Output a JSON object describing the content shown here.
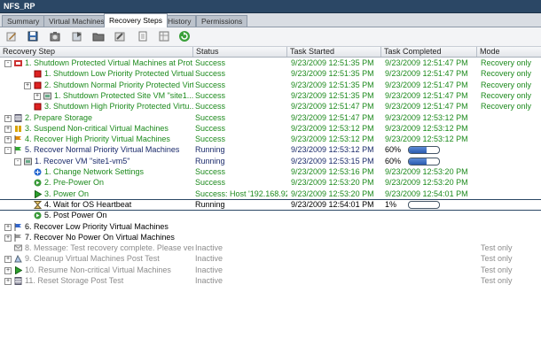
{
  "window": {
    "title": "NFS_RP"
  },
  "tabs": [
    {
      "label": "Summary",
      "active": false
    },
    {
      "label": "Virtual Machines",
      "active": false
    },
    {
      "label": "Recovery Steps",
      "active": true
    },
    {
      "label": "History",
      "active": false
    },
    {
      "label": "Permissions",
      "active": false
    }
  ],
  "toolbar": {
    "buttons": [
      "edit-icon",
      "save-icon",
      "camera-icon",
      "export-icon",
      "folder-icon",
      "wrench-icon",
      "document-icon",
      "grid-icon",
      "refresh-icon"
    ]
  },
  "columns": {
    "step": "Recovery Step",
    "status": "Status",
    "started": "Task Started",
    "completed": "Task Completed",
    "mode": "Mode"
  },
  "rows": [
    {
      "step": "1. Shutdown Protected Virtual Machines at Prot...",
      "status": "Success",
      "started": "9/23/2009 12:51:35 PM",
      "completed": "9/23/2009 12:51:47 PM",
      "mode": "Recovery only",
      "color": "green",
      "icon": "shutdown-group-icon"
    },
    {
      "step": "1. Shutdown Low Priority Protected Virtual...",
      "status": "Success",
      "started": "9/23/2009 12:51:35 PM",
      "completed": "9/23/2009 12:51:47 PM",
      "mode": "Recovery only",
      "color": "green",
      "icon": "stop-icon"
    },
    {
      "step": "2. Shutdown Normal Priority Protected Virtu...",
      "status": "Success",
      "started": "9/23/2009 12:51:35 PM",
      "completed": "9/23/2009 12:51:47 PM",
      "mode": "Recovery only",
      "color": "green",
      "icon": "stop-icon"
    },
    {
      "step": "1. Shutdown Protected Site VM \"site1...",
      "status": "Success",
      "started": "9/23/2009 12:51:35 PM",
      "completed": "9/23/2009 12:51:47 PM",
      "mode": "Recovery only",
      "color": "green",
      "icon": "vm-icon"
    },
    {
      "step": "3. Shutdown High Priority Protected Virtu...",
      "status": "Success",
      "started": "9/23/2009 12:51:47 PM",
      "completed": "9/23/2009 12:51:47 PM",
      "mode": "Recovery only",
      "color": "green",
      "icon": "stop-icon"
    },
    {
      "step": "2. Prepare Storage",
      "status": "Success",
      "started": "9/23/2009 12:51:47 PM",
      "completed": "9/23/2009 12:53:12 PM",
      "mode": "",
      "color": "green",
      "icon": "storage-icon"
    },
    {
      "step": "3. Suspend Non-critical Virtual Machines",
      "status": "Success",
      "started": "9/23/2009 12:53:12 PM",
      "completed": "9/23/2009 12:53:12 PM",
      "mode": "",
      "color": "green",
      "icon": "pause-icon"
    },
    {
      "step": "4. Recover High Priority Virtual Machines",
      "status": "Success",
      "started": "9/23/2009 12:53:12 PM",
      "completed": "9/23/2009 12:53:12 PM",
      "mode": "",
      "color": "green",
      "icon": "flag-icon"
    },
    {
      "step": "5. Recover Normal Priority Virtual Machines",
      "status": "Running",
      "started": "9/23/2009 12:53:12 PM",
      "completed": "60%",
      "mode": "",
      "color": "navy",
      "icon": "flag-green-icon",
      "progress": 0.6
    },
    {
      "step": "1. Recover VM \"site1-vm5\"",
      "status": "Running",
      "started": "9/23/2009 12:53:15 PM",
      "completed": "60%",
      "mode": "",
      "color": "navy",
      "icon": "vm-icon",
      "progress": 0.6
    },
    {
      "step": "1. Change Network Settings",
      "status": "Success",
      "started": "9/23/2009 12:53:16 PM",
      "completed": "9/23/2009 12:53:20 PM",
      "mode": "",
      "color": "green",
      "icon": "network-icon"
    },
    {
      "step": "2. Pre-Power On",
      "status": "Success",
      "started": "9/23/2009 12:53:20 PM",
      "completed": "9/23/2009 12:53:20 PM",
      "mode": "",
      "color": "green",
      "icon": "script-icon"
    },
    {
      "step": "3. Power On",
      "status": "Success: Host '192.168.92....",
      "started": "9/23/2009 12:53:20 PM",
      "completed": "9/23/2009 12:54:01 PM",
      "mode": "",
      "color": "green",
      "icon": "play-icon"
    },
    {
      "step": "4. Wait for OS Heartbeat",
      "status": "Running",
      "started": "9/23/2009 12:54:01 PM",
      "completed": "1%",
      "mode": "",
      "color": "black",
      "icon": "hourglass-icon",
      "progress": 0.01,
      "selected": true
    },
    {
      "step": "5. Post Power On",
      "status": "",
      "started": "",
      "completed": "",
      "mode": "",
      "color": "black",
      "icon": "script-icon"
    },
    {
      "step": "6. Recover Low Priority Virtual Machines",
      "status": "",
      "started": "",
      "completed": "",
      "mode": "",
      "color": "black",
      "icon": "flag-blue-icon"
    },
    {
      "step": "7. Recover No Power On Virtual Machines",
      "status": "",
      "started": "",
      "completed": "",
      "mode": "",
      "color": "black",
      "icon": "flag-gray-icon"
    },
    {
      "step": "8. Message: Test recovery complete. Please ver...",
      "status": "Inactive",
      "started": "",
      "completed": "",
      "mode": "Test only",
      "color": "gray",
      "icon": "message-icon"
    },
    {
      "step": "9. Cleanup Virtual Machines Post Test",
      "status": "Inactive",
      "started": "",
      "completed": "",
      "mode": "Test only",
      "color": "gray",
      "icon": "cleanup-icon"
    },
    {
      "step": "10. Resume Non-critical Virtual Machines",
      "status": "Inactive",
      "started": "",
      "completed": "",
      "mode": "Test only",
      "color": "gray",
      "icon": "play-icon"
    },
    {
      "step": "11. Reset Storage Post Test",
      "status": "Inactive",
      "started": "",
      "completed": "",
      "mode": "Test only",
      "color": "gray",
      "icon": "storage-icon"
    }
  ],
  "colors": {
    "green": "#1d8a1d",
    "navy": "#1b2b6b",
    "gray": "#8c8c8c",
    "title_bar": "#2b4765"
  }
}
